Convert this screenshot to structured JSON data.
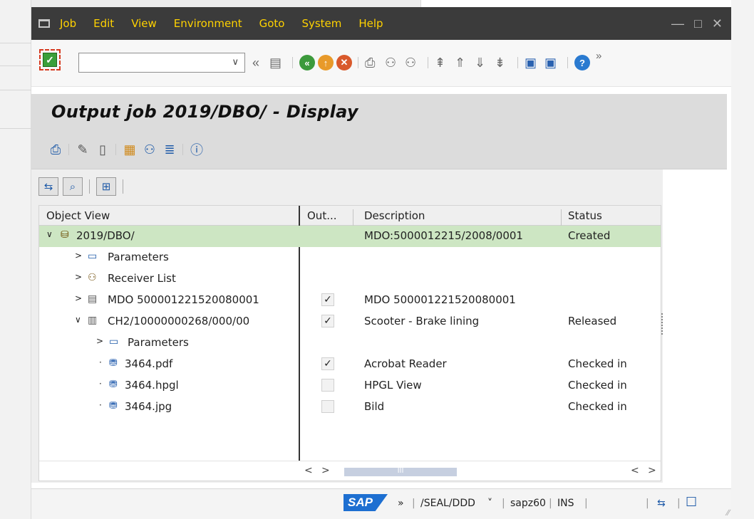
{
  "menu": {
    "items": [
      "Job",
      "Edit",
      "View",
      "Environment",
      "Goto",
      "System",
      "Help"
    ],
    "window_controls": [
      "minimize-icon",
      "maximize-icon",
      "close-icon"
    ]
  },
  "system_toolbar": {
    "command_field_value": "",
    "expand_label": "»",
    "collapse_label": "«"
  },
  "screen": {
    "title": "Output job 2019/DBO/ - Display"
  },
  "tree": {
    "columns": [
      "Object View",
      "Out...",
      "Description",
      "Status"
    ],
    "rows": [
      {
        "label": "2019/DBO/",
        "toggle": "∨",
        "icon": "job-folder-icon",
        "checked": null,
        "description": "MDO:5000012215/2008/0001",
        "status": "Created",
        "level": 0,
        "selected": true
      },
      {
        "label": "Parameters",
        "toggle": ">",
        "icon": "parameters-icon",
        "checked": null,
        "description": "",
        "status": "",
        "level": 1,
        "selected": false
      },
      {
        "label": "Receiver List",
        "toggle": ">",
        "icon": "receivers-icon",
        "checked": null,
        "description": "",
        "status": "",
        "level": 1,
        "selected": false
      },
      {
        "label": "MDO 500001221520080001",
        "toggle": ">",
        "icon": "document-icon",
        "checked": true,
        "description": "MDO 500001221520080001",
        "status": "",
        "level": 1,
        "selected": false
      },
      {
        "label": "CH2/10000000268/000/00",
        "toggle": "∨",
        "icon": "document-info-icon",
        "checked": true,
        "description": "Scooter - Brake lining",
        "status": "Released",
        "level": 1,
        "selected": false
      },
      {
        "label": "Parameters",
        "toggle": ">",
        "icon": "parameters-icon",
        "checked": null,
        "description": "",
        "status": "",
        "level": 2,
        "selected": false
      },
      {
        "label": "3464.pdf",
        "toggle": "·",
        "icon": "file-object-icon",
        "checked": true,
        "description": "Acrobat Reader",
        "status": "Checked in",
        "level": 2,
        "selected": false
      },
      {
        "label": "3464.hpgl",
        "toggle": "·",
        "icon": "file-object-icon",
        "checked": false,
        "description": "HPGL View",
        "status": "Checked in",
        "level": 2,
        "selected": false
      },
      {
        "label": "3464.jpg",
        "toggle": "·",
        "icon": "file-object-icon",
        "checked": false,
        "description": "Bild",
        "status": "Checked in",
        "level": 2,
        "selected": false
      }
    ],
    "scroll_left": "<",
    "scroll_right": ">",
    "scroll_thumb": "III"
  },
  "status_bar": {
    "logo": "SAP",
    "expand": "»",
    "system": "/SEAL/DDD",
    "system_dropdown": "˅",
    "server": "sapz60",
    "mode": "INS"
  },
  "colors": {
    "menu_bar": "#3b3b3b",
    "menu_text": "#ffd200",
    "selected_row": "#cde6c3",
    "sap_blue": "#1d6fd1"
  }
}
